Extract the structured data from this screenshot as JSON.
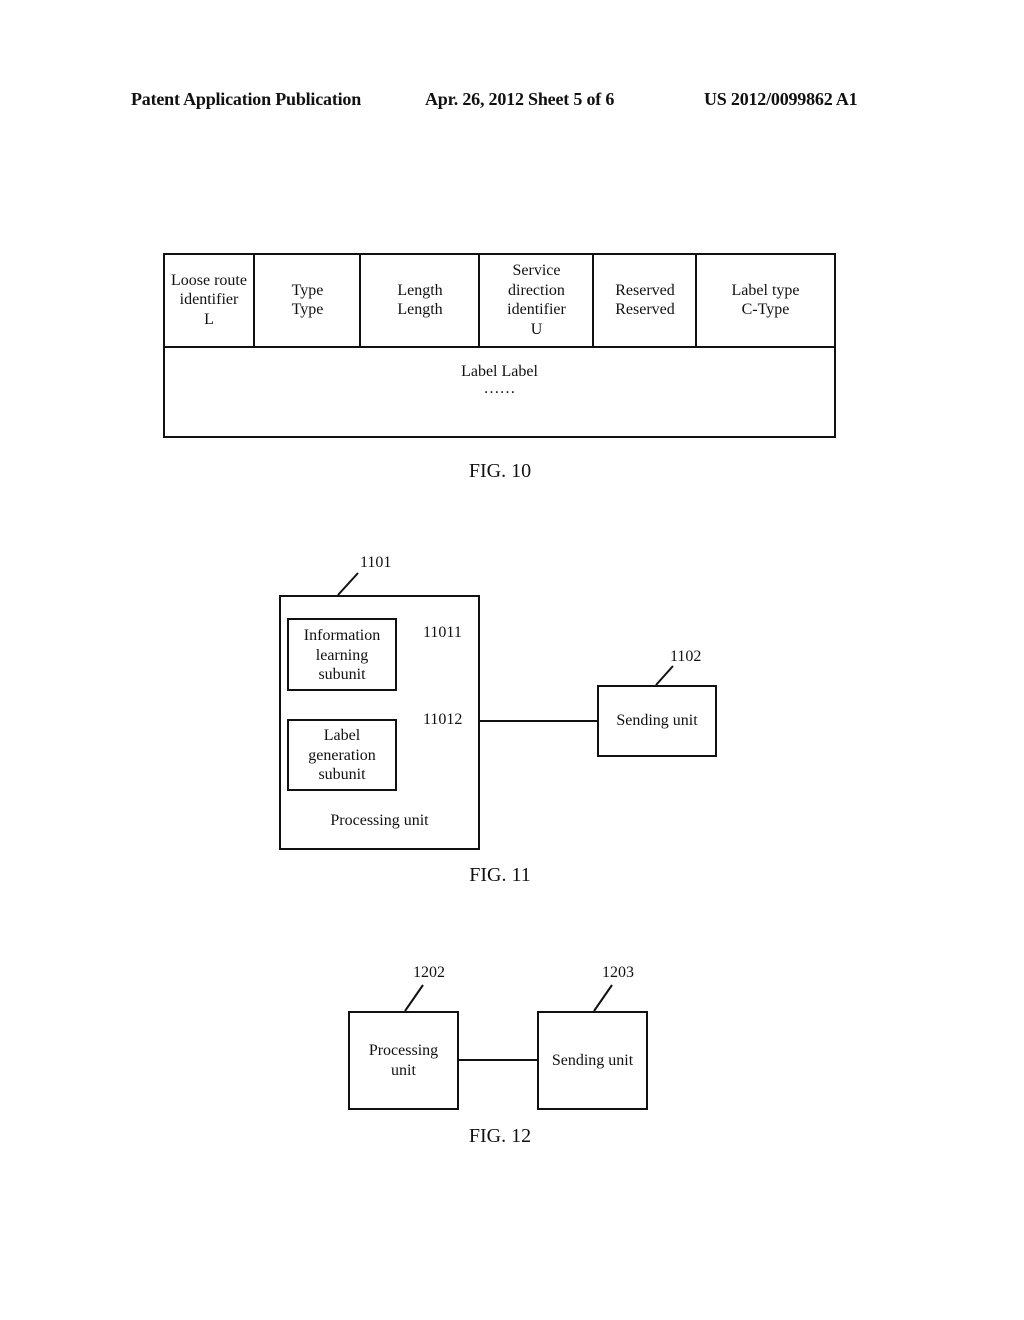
{
  "header": {
    "left": "Patent Application Publication",
    "center": "Apr. 26, 2012  Sheet 5 of 6",
    "right": "US 2012/0099862 A1"
  },
  "fig10": {
    "caption": "FIG. 10",
    "header_cells": [
      {
        "lines": [
          "Loose route",
          "identifier",
          "L"
        ]
      },
      {
        "lines": [
          "Type",
          "Type"
        ]
      },
      {
        "lines": [
          "Length",
          "Length"
        ]
      },
      {
        "lines": [
          "Service",
          "direction",
          "identifier",
          "U"
        ]
      },
      {
        "lines": [
          "Reserved",
          "Reserved"
        ]
      },
      {
        "lines": [
          "Label type",
          "C-Type"
        ]
      }
    ],
    "body_cell": {
      "lines": [
        "Label Label",
        "……"
      ]
    }
  },
  "fig11": {
    "caption": "FIG. 11",
    "processing_unit": {
      "ref": "1101",
      "label": "Processing unit"
    },
    "info_subunit": {
      "ref": "11011",
      "lines": [
        "Information",
        "learning",
        "subunit"
      ]
    },
    "label_subunit": {
      "ref": "11012",
      "lines": [
        "Label",
        "generation",
        "subunit"
      ]
    },
    "sending_unit": {
      "ref": "1102",
      "label": "Sending unit"
    }
  },
  "fig12": {
    "caption": "FIG. 12",
    "processing_unit": {
      "ref": "1202",
      "lines": [
        "Processing",
        "unit"
      ]
    },
    "sending_unit": {
      "ref": "1203",
      "label": "Sending unit"
    }
  }
}
